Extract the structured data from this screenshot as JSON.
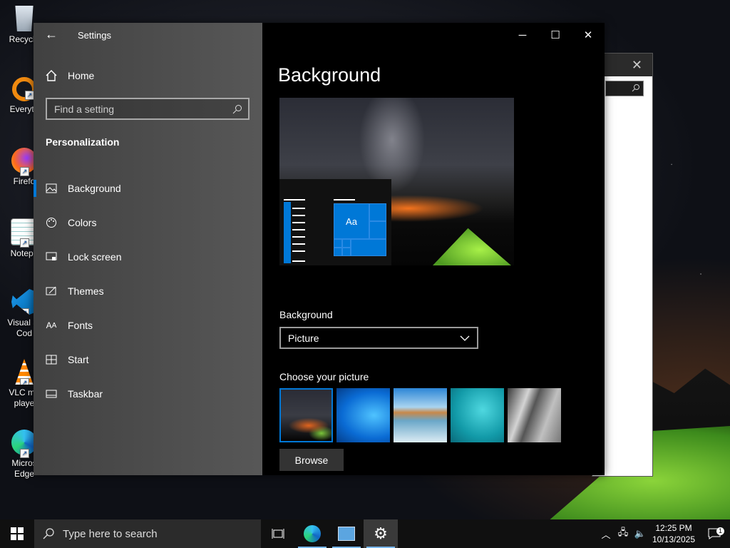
{
  "desktop": {
    "icons": [
      {
        "label": "Recycle",
        "icon": "recycle-bin-icon"
      },
      {
        "label": "Everyth",
        "icon": "everything-search-icon"
      },
      {
        "label": "Firefo",
        "icon": "firefox-icon"
      },
      {
        "label": "Notepa",
        "icon": "notepad-icon"
      },
      {
        "label": "Visual St",
        "label2": "Cod",
        "icon": "vscode-icon"
      },
      {
        "label": "VLC me",
        "label2": "playe",
        "icon": "vlc-icon"
      },
      {
        "label": "Micros",
        "label2": "Edge",
        "icon": "edge-icon"
      }
    ]
  },
  "settings": {
    "app_title": "Settings",
    "home_label": "Home",
    "search_placeholder": "Find a setting",
    "section_title": "Personalization",
    "nav": [
      {
        "label": "Background",
        "icon": "picture-icon",
        "active": true
      },
      {
        "label": "Colors",
        "icon": "palette-icon",
        "active": false
      },
      {
        "label": "Lock screen",
        "icon": "lock-screen-icon",
        "active": false
      },
      {
        "label": "Themes",
        "icon": "themes-icon",
        "active": false
      },
      {
        "label": "Fonts",
        "icon": "fonts-icon",
        "active": false
      },
      {
        "label": "Start",
        "icon": "start-icon",
        "active": false
      },
      {
        "label": "Taskbar",
        "icon": "taskbar-icon",
        "active": false
      }
    ],
    "page_title": "Background",
    "preview_tile_text": "Aa",
    "background_label": "Background",
    "background_value": "Picture",
    "choose_label": "Choose your picture",
    "browse_label": "Browse",
    "accent_color": "#0078d7"
  },
  "taskbar": {
    "search_placeholder": "Type here to search",
    "time": "12:25 PM",
    "date": "10/13/2025",
    "notification_count": "1"
  }
}
